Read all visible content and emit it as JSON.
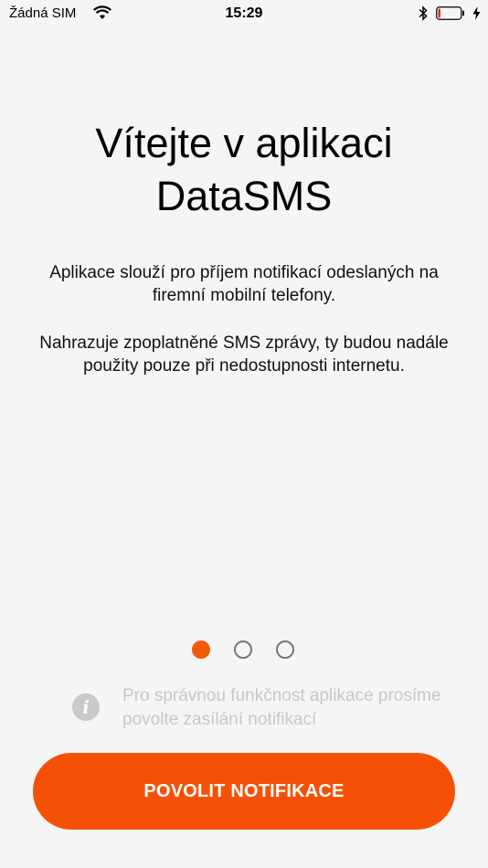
{
  "status_bar": {
    "carrier": "Žádná SIM",
    "time": "15:29",
    "battery_level": 0.1
  },
  "welcome": {
    "title_line1": "Vítejte v aplikaci",
    "title_line2": "DataSMS",
    "description_1": "Aplikace slouží pro příjem notifikací odeslaných na firemní mobilní telefony.",
    "description_2": "Nahrazuje zpoplatněné SMS zprávy, ty budou nadále použity pouze při nedostupnosti internetu."
  },
  "pager": {
    "page_count": 3,
    "active_index": 0
  },
  "info": {
    "icon": "info-icon",
    "text": "Pro správnou funkčnost aplikace prosíme povolte zasílání notifikací"
  },
  "button": {
    "label": "POVOLIT NOTIFIKACE"
  },
  "colors": {
    "accent": "#f55106",
    "background": "#f5f5f5"
  }
}
